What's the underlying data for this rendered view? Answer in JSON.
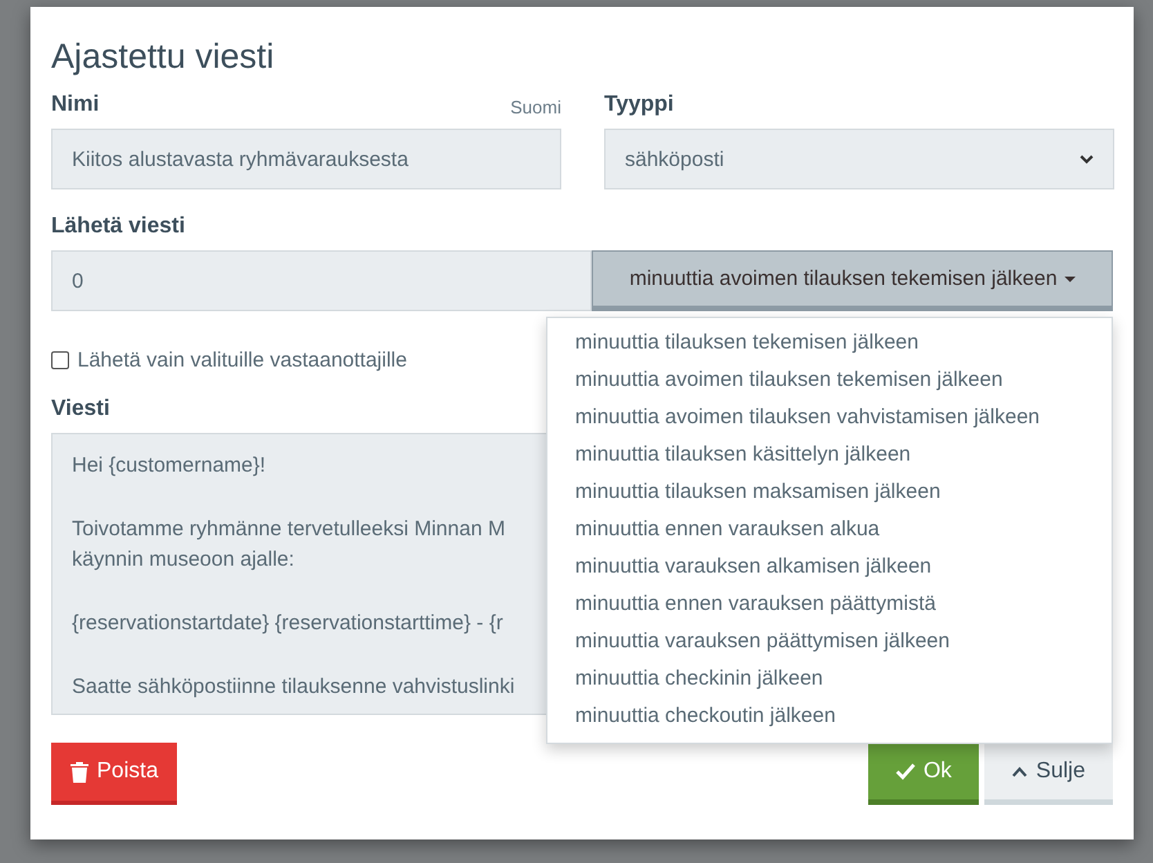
{
  "dialog": {
    "title": "Ajastettu viesti"
  },
  "name_field": {
    "label": "Nimi",
    "language": "Suomi",
    "value": "Kiitos alustavasta ryhmävarauksesta"
  },
  "type_field": {
    "label": "Tyyppi",
    "value": "sähköposti"
  },
  "send_field": {
    "label": "Lähetä viesti",
    "value": "0",
    "unit": "minuuttia avoimen tilauksen tekemisen jälkeen",
    "expanded": true
  },
  "unit_options": [
    "minuuttia tilauksen tekemisen jälkeen",
    "minuuttia avoimen tilauksen tekemisen jälkeen",
    "minuuttia avoimen tilauksen vahvistamisen jälkeen",
    "minuuttia tilauksen käsittelyn jälkeen",
    "minuuttia tilauksen maksamisen jälkeen",
    "minuuttia ennen varauksen alkua",
    "minuuttia varauksen alkamisen jälkeen",
    "minuuttia ennen varauksen päättymistä",
    "minuuttia varauksen päättymisen jälkeen",
    "minuuttia checkinin jälkeen",
    "minuuttia checkoutin jälkeen"
  ],
  "recipients_checkbox": {
    "label": "Lähetä vain valituille vastaanottajille",
    "checked": false
  },
  "message": {
    "label": "Viesti",
    "paragraphs": [
      [
        "Hei {customername}!"
      ],
      [
        "Toivotamme ryhmänne tervetulleeksi Minnan M",
        "käynnin museoon ajalle:"
      ],
      [
        "{reservationstartdate} {reservationstarttime} - {r"
      ],
      [
        "Saatte sähköpostiinne tilauksenne vahvistuslinki"
      ]
    ]
  },
  "buttons": [
    {
      "kind": "delete",
      "label": "Poista"
    },
    {
      "kind": "ok",
      "label": "Ok"
    },
    {
      "kind": "close",
      "label": "Sulje"
    }
  ]
}
